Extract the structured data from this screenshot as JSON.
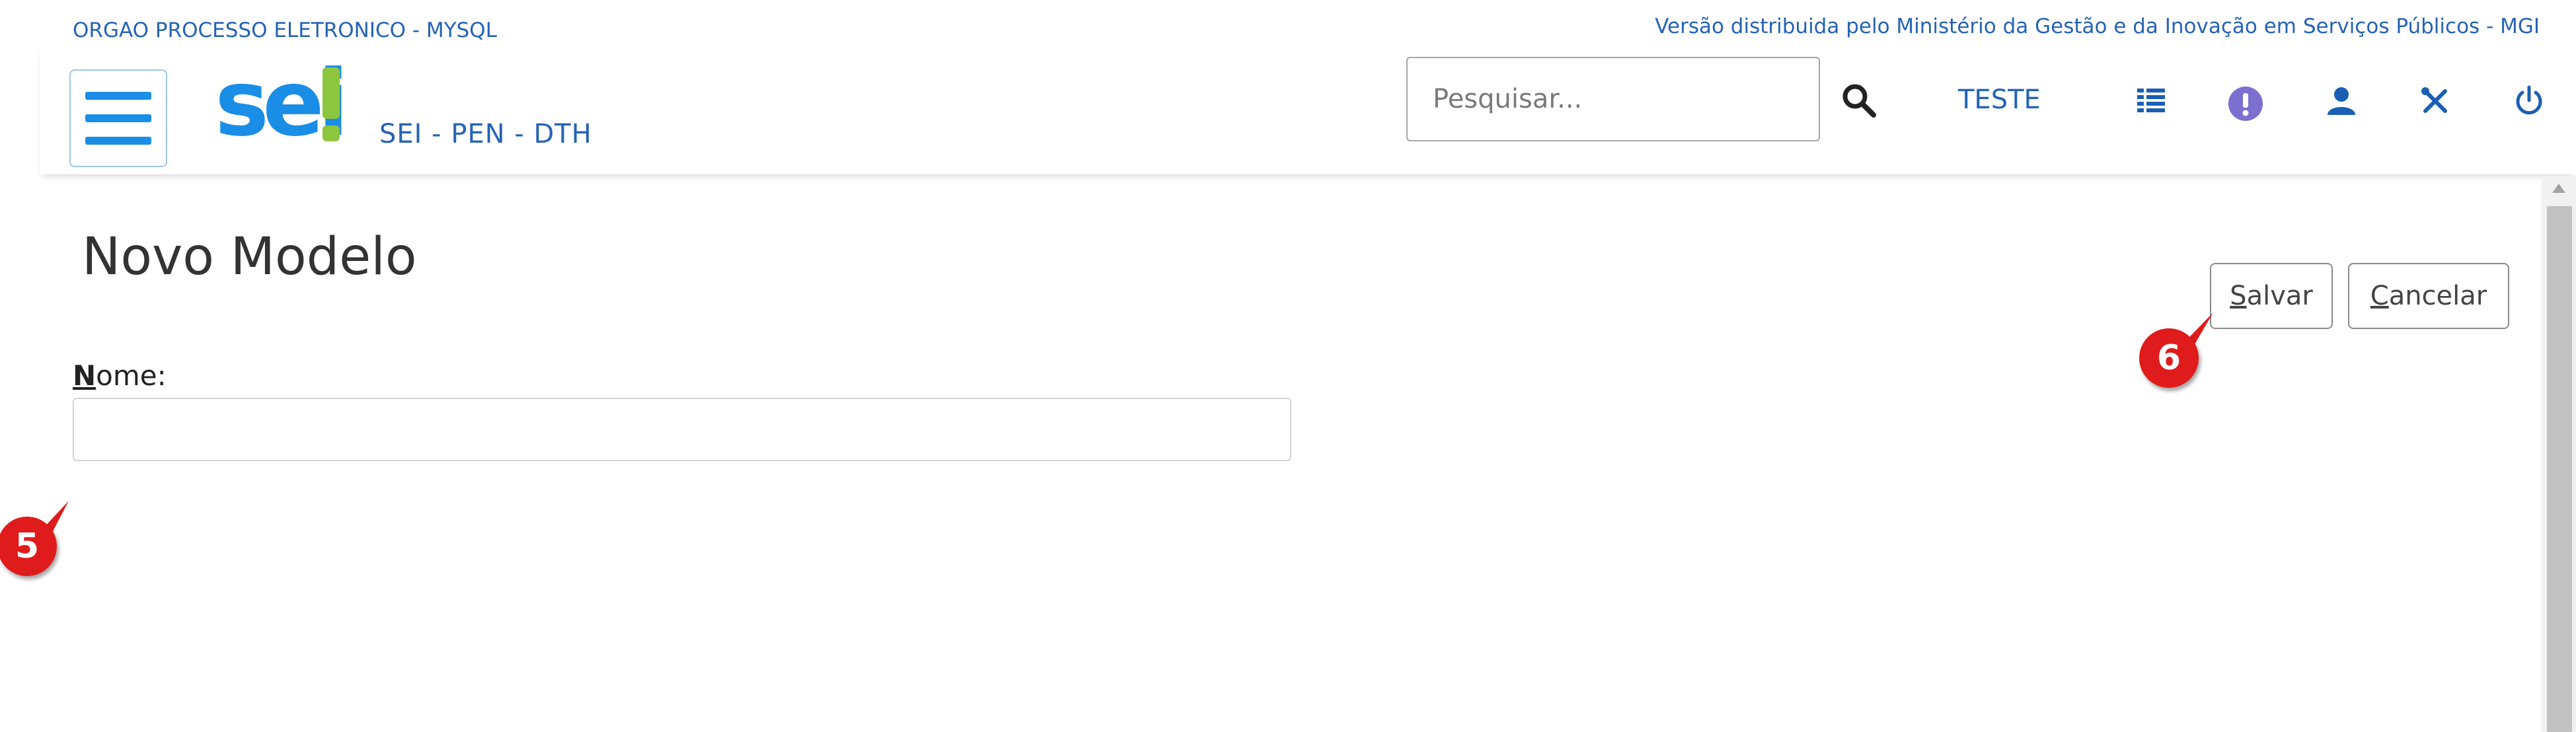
{
  "top": {
    "org_label": "ORGAO PROCESSO ELETRONICO - MYSQL",
    "distribution_note": "Versão distribuida pelo Ministério da Gestão e da Inovação em Serviços Públicos - MGI"
  },
  "header": {
    "logo_text": "sei",
    "system_name": "SEI - PEN - DTH",
    "search_placeholder": "Pesquisar...",
    "unit_label": "TESTE",
    "icons": [
      "menu-icon",
      "search-icon",
      "list-icon",
      "alert-icon",
      "user-icon",
      "tools-icon",
      "power-icon"
    ],
    "colors": {
      "brand_blue": "#1a8ee6",
      "text_blue": "#2563b6",
      "logo_green": "#8cc63f",
      "alert_purple": "#7b6fd0"
    }
  },
  "main": {
    "title": "Novo Modelo",
    "save_button": {
      "accesskey": "S",
      "rest": "alvar"
    },
    "cancel_button": {
      "accesskey": "C",
      "rest": "ancelar"
    },
    "name_field": {
      "accesskey": "N",
      "label_rest": "ome:",
      "value": ""
    }
  },
  "callouts": {
    "five": "5",
    "six": "6"
  }
}
